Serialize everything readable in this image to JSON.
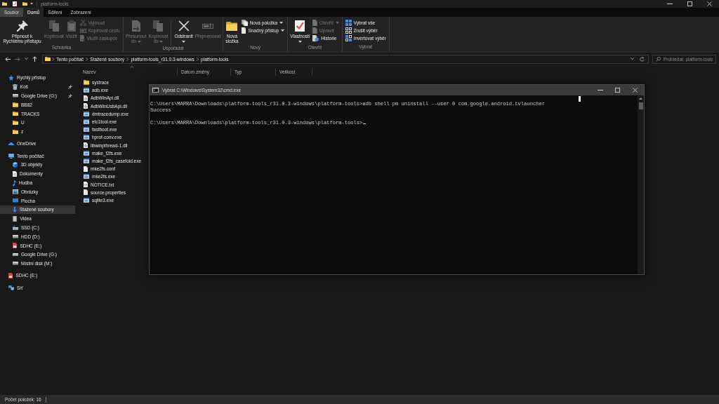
{
  "window": {
    "title": "platform-tools"
  },
  "ribbon": {
    "tabs": [
      {
        "label": "Soubor",
        "kind": "menu",
        "selected": false
      },
      {
        "label": "Domů",
        "kind": "tab",
        "selected": true
      },
      {
        "label": "Sdílení",
        "kind": "tab",
        "selected": false
      },
      {
        "label": "Zobrazení",
        "kind": "tab",
        "selected": false
      }
    ],
    "groups": [
      {
        "label": "Schránka",
        "items": [
          {
            "kind": "large",
            "label": "Připnout k Rychlému přístupu",
            "disabled": false,
            "dropdown": false
          },
          {
            "kind": "large",
            "label": "Kopírovat",
            "disabled": true,
            "dropdown": false
          },
          {
            "kind": "large",
            "label": "Vložit",
            "disabled": true,
            "dropdown": false
          },
          {
            "kind": "stack",
            "items": [
              {
                "label": "Vyjmout",
                "disabled": true,
                "dropdown": false
              },
              {
                "label": "Kopírovat cestu",
                "disabled": true,
                "dropdown": false
              },
              {
                "label": "Vložit zástupce",
                "disabled": true,
                "dropdown": false
              }
            ]
          }
        ]
      },
      {
        "label": "Uspořádat",
        "items": [
          {
            "kind": "large",
            "label": "Přesunout do",
            "disabled": true,
            "dropdown": true
          },
          {
            "kind": "large",
            "label": "Kopírovat do",
            "disabled": true,
            "dropdown": true
          },
          {
            "kind": "separator"
          },
          {
            "kind": "large",
            "label": "Odstranit",
            "disabled": false,
            "dropdown": true
          },
          {
            "kind": "large",
            "label": "Přejmenovat",
            "disabled": true,
            "dropdown": false
          }
        ]
      },
      {
        "label": "Nový",
        "items": [
          {
            "kind": "large",
            "label": "Nová složka",
            "disabled": false,
            "dropdown": false
          },
          {
            "kind": "stack",
            "items": [
              {
                "label": "Nová položka",
                "disabled": false,
                "dropdown": true
              },
              {
                "label": "Snadný přístup",
                "disabled": false,
                "dropdown": true
              }
            ]
          }
        ]
      },
      {
        "label": "Otevřít",
        "items": [
          {
            "kind": "large",
            "label": "Vlastnosti",
            "disabled": false,
            "dropdown": true
          },
          {
            "kind": "stack",
            "items": [
              {
                "label": "Otevřít",
                "disabled": true,
                "dropdown": true
              },
              {
                "label": "Upravit",
                "disabled": true,
                "dropdown": false
              },
              {
                "label": "Historie",
                "disabled": false,
                "dropdown": false
              }
            ]
          }
        ]
      },
      {
        "label": "Vybrat",
        "items": [
          {
            "kind": "stack",
            "items": [
              {
                "label": "Vybrat vše",
                "disabled": false,
                "dropdown": false
              },
              {
                "label": "Zrušit výběr",
                "disabled": false,
                "dropdown": false
              },
              {
                "label": "Invertovat výběr",
                "disabled": false,
                "dropdown": false
              }
            ]
          }
        ]
      }
    ]
  },
  "navigation": {
    "back": {
      "disabled": false
    },
    "forward": {
      "disabled": true
    },
    "up": {
      "disabled": false
    }
  },
  "address_bar": {
    "path": [
      "Tento počítač",
      "Stažené soubory",
      "platform-tools_r31.0.3-windows",
      "platform-tools"
    ]
  },
  "search": {
    "placeholder": "Prohledat: platform-tools"
  },
  "sidebar": {
    "items": [
      {
        "label": "Rychlý přístup",
        "kind": "quick-access",
        "selected": false,
        "children": [
          {
            "label": "Koš",
            "kind": "recycle-bin",
            "pinned": true,
            "selected": false
          },
          {
            "label": "Google Drive (G:)",
            "kind": "drive",
            "pinned": true,
            "selected": false
          },
          {
            "label": "BB82",
            "kind": "folder",
            "pinned": false,
            "selected": false
          },
          {
            "label": "TRACKS",
            "kind": "folder",
            "pinned": false,
            "selected": false
          },
          {
            "label": "U",
            "kind": "folder",
            "pinned": false,
            "selected": false
          },
          {
            "label": "z",
            "kind": "folder",
            "pinned": false,
            "selected": false
          }
        ]
      },
      {
        "label": "OneDrive",
        "kind": "cloud",
        "selected": false
      },
      {
        "label": "Tento počítač",
        "kind": "computer",
        "selected": false,
        "children": [
          {
            "label": "3D objekty",
            "kind": "objects-3d",
            "selected": false
          },
          {
            "label": "Dokumenty",
            "kind": "documents",
            "selected": false
          },
          {
            "label": "Hudba",
            "kind": "music",
            "selected": false
          },
          {
            "label": "Obrázky",
            "kind": "pictures",
            "selected": false
          },
          {
            "label": "Plocha",
            "kind": "desktop",
            "selected": false
          },
          {
            "label": "Stažené soubory",
            "kind": "downloads",
            "selected": true
          },
          {
            "label": "Videa",
            "kind": "videos",
            "selected": false
          },
          {
            "label": "SSD (C:)",
            "kind": "system-drive",
            "selected": false
          },
          {
            "label": "HDD (D:)",
            "kind": "drive",
            "selected": false
          },
          {
            "label": "SDHC (E:)",
            "kind": "sd-card",
            "selected": false
          },
          {
            "label": "Google Drive (G:)",
            "kind": "drive",
            "selected": false
          },
          {
            "label": "Místní disk (M:)",
            "kind": "drive",
            "selected": false
          }
        ]
      },
      {
        "label": "SDHC (E:)",
        "kind": "sd-card",
        "selected": false
      },
      {
        "label": "Síť",
        "kind": "network",
        "selected": false
      }
    ]
  },
  "file_list": {
    "columns": [
      {
        "label": "Název",
        "sorted": true
      },
      {
        "label": "Datum změny",
        "sorted": false
      },
      {
        "label": "Typ",
        "sorted": false
      },
      {
        "label": "Velikost",
        "sorted": false
      }
    ],
    "files": [
      {
        "name": "systrace",
        "kind": "folder",
        "selected": false
      },
      {
        "name": "adb.exe",
        "kind": "exe",
        "selected": false
      },
      {
        "name": "AdbWinApi.dll",
        "kind": "dll",
        "selected": false
      },
      {
        "name": "AdbWinUsbApi.dll",
        "kind": "dll",
        "selected": false
      },
      {
        "name": "dmtracedump.exe",
        "kind": "exe",
        "selected": false
      },
      {
        "name": "etc1tool.exe",
        "kind": "exe",
        "selected": false
      },
      {
        "name": "fastboot.exe",
        "kind": "exe",
        "selected": false
      },
      {
        "name": "hprof-conv.exe",
        "kind": "exe",
        "selected": false
      },
      {
        "name": "libwinpthread-1.dll",
        "kind": "dll",
        "selected": false
      },
      {
        "name": "make_f2fs.exe",
        "kind": "exe",
        "selected": false
      },
      {
        "name": "make_f2fs_casefold.exe",
        "kind": "exe",
        "selected": false
      },
      {
        "name": "mke2fs.conf",
        "kind": "file",
        "selected": false
      },
      {
        "name": "mke2fs.exe",
        "kind": "exe",
        "selected": false
      },
      {
        "name": "NOTICE.txt",
        "kind": "text",
        "selected": false
      },
      {
        "name": "source.properties",
        "kind": "file",
        "selected": false
      },
      {
        "name": "sqlite3.exe",
        "kind": "exe",
        "selected": false
      }
    ]
  },
  "status_bar": {
    "item_count": "Počet položek: 16"
  },
  "console": {
    "title": "Vybrat C:\\Windows\\System32\\cmd.exe",
    "blocks": [
      [
        "C:\\Users\\MARRA\\Downloads\\platform-tools_r31.0.3-windows\\platform-tools>adb shell pm uninstall --user 0 com.google.android.tvlauncher",
        "Success"
      ],
      [
        "C:\\Users\\MARRA\\Downloads\\platform-tools_r31.0.3-windows\\platform-tools>"
      ]
    ],
    "cursor": true
  }
}
